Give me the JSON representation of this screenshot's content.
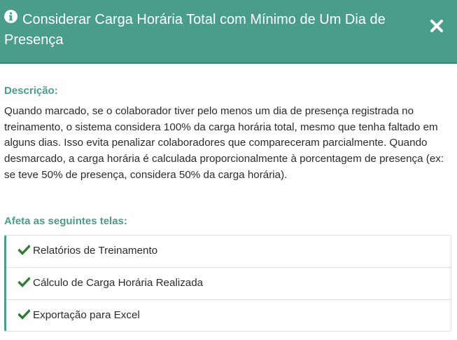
{
  "header": {
    "title": "Considerar Carga Horária Total com Mínimo de Um Dia de Presença",
    "icon": "info-circle-icon",
    "close_icon": "close-icon"
  },
  "body": {
    "description_label": "Descrição:",
    "description_text": "Quando marcado, se o colaborador tiver pelo menos um dia de presença registrada no treinamento, o sistema considera 100% da carga horária total, mesmo que tenha faltado em alguns dias. Isso evita penalizar colaboradores que compareceram parcialmente. Quando desmarcado, a carga horária é calculada proporcionalmente à porcentagem de presença (ex: se teve 50% de presença, considera 50% da carga horária).",
    "affects_label": "Afeta as seguintes telas:",
    "screens": [
      {
        "label": "Relatórios de Treinamento",
        "icon": "check-icon"
      },
      {
        "label": "Cálculo de Carga Horária Realizada",
        "icon": "check-icon"
      },
      {
        "label": "Exportação para Excel",
        "icon": "check-icon"
      }
    ]
  },
  "colors": {
    "header_bg": "#4a9d8a",
    "accent": "#4a9d8a",
    "check": "#2e7d32",
    "text": "#2b2b2b"
  }
}
